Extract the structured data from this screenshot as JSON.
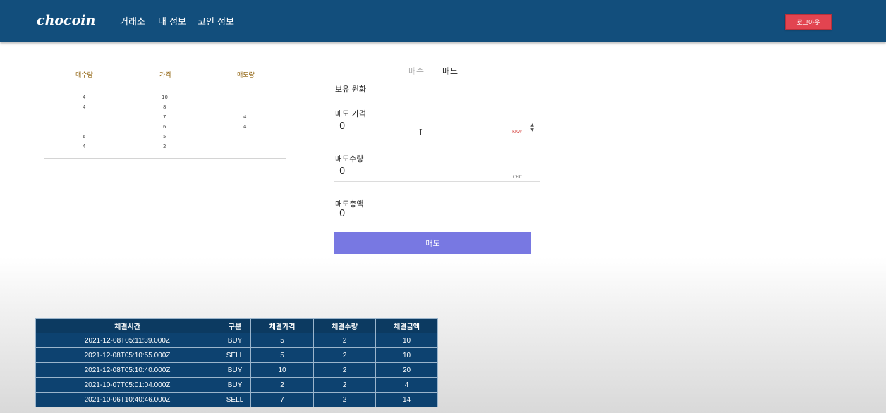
{
  "header": {
    "brand": "chocoin",
    "nav": [
      "거래소",
      "내 정보",
      "코인 정보"
    ],
    "logout_label": "로그아웃"
  },
  "orderbook": {
    "headers": {
      "buy_qty": "매수량",
      "price": "가격",
      "sell_qty": "매도량"
    },
    "rows": [
      {
        "buy_qty": "4",
        "price": "10",
        "sell_qty": ""
      },
      {
        "buy_qty": "4",
        "price": "8",
        "sell_qty": ""
      },
      {
        "buy_qty": "",
        "price": "7",
        "sell_qty": "4"
      },
      {
        "buy_qty": "",
        "price": "6",
        "sell_qty": "4"
      },
      {
        "buy_qty": "6",
        "price": "5",
        "sell_qty": ""
      },
      {
        "buy_qty": "4",
        "price": "2",
        "sell_qty": ""
      }
    ]
  },
  "order_form": {
    "tabs": {
      "buy": "매수",
      "sell": "매도"
    },
    "active_tab": "sell",
    "holding_label": "보유 원화",
    "price_label": "매도 가격",
    "price_value": "0",
    "price_unit": "KRW",
    "qty_label": "매도수량",
    "qty_value": "0",
    "qty_unit": "CHC",
    "total_label": "매도총액",
    "total_value": "0",
    "submit_label": "매도",
    "colors": {
      "submit": "#7878e2",
      "krw_unit": "#d9534f"
    }
  },
  "trades": {
    "headers": [
      "체결시간",
      "구분",
      "체결가격",
      "체결수량",
      "체결금액"
    ],
    "rows": [
      [
        "2021-12-08T05:11:39.000Z",
        "BUY",
        "5",
        "2",
        "10"
      ],
      [
        "2021-12-08T05:10:55.000Z",
        "SELL",
        "5",
        "2",
        "10"
      ],
      [
        "2021-12-08T05:10:40.000Z",
        "BUY",
        "10",
        "2",
        "20"
      ],
      [
        "2021-10-07T05:01:04.000Z",
        "BUY",
        "2",
        "2",
        "4"
      ],
      [
        "2021-10-06T10:40:46.000Z",
        "SELL",
        "7",
        "2",
        "14"
      ]
    ]
  },
  "colors": {
    "navbar": "#124e7c",
    "logout": "#e24450",
    "table": "#0d4270"
  }
}
